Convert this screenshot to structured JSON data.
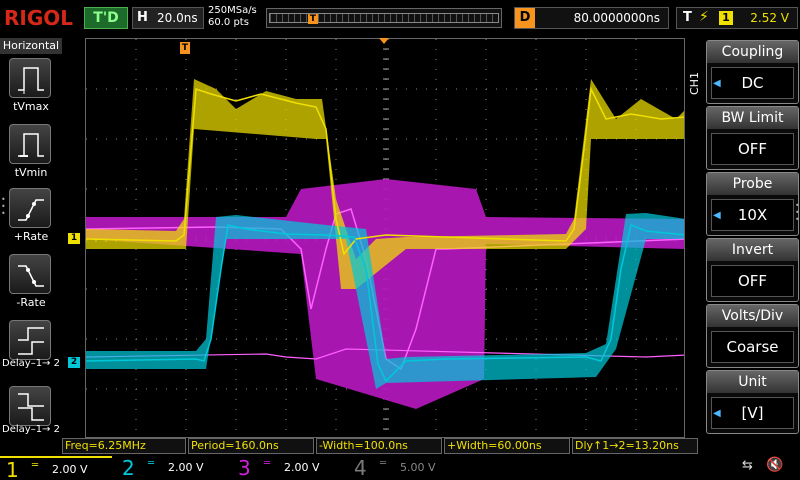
{
  "topbar": {
    "logo": "RIGOL",
    "trigger_status": "T'D",
    "timebase_label": "H",
    "timebase_value": "20.0ns",
    "sample_rate": "250MSa/s",
    "sample_points": "60.0 pts",
    "delay_label": "D",
    "delay_value": "80.0000000ns",
    "trigger_label": "T",
    "trigger_edge": "⚡",
    "trigger_source": "1",
    "trigger_level": "2.52 V"
  },
  "left": {
    "title": "Horizontal",
    "buttons": [
      {
        "label": "tVmax"
      },
      {
        "label": "tVmin"
      },
      {
        "label": "+Rate"
      },
      {
        "label": "-Rate"
      },
      {
        "label": "Delay–1→ 2"
      },
      {
        "label": "Delay–1→ 2"
      }
    ]
  },
  "right": {
    "channel_tag": "CH1",
    "settings": [
      {
        "title": "Coupling",
        "value": "DC"
      },
      {
        "title": "BW Limit",
        "value": "OFF"
      },
      {
        "title": "Probe",
        "value": "10X"
      },
      {
        "title": "Invert",
        "value": "OFF"
      },
      {
        "title": "Volts/Div",
        "value": "Coarse"
      },
      {
        "title": "Unit",
        "value": "[V]"
      }
    ]
  },
  "measurements": [
    {
      "text": "Freq=6.25MHz"
    },
    {
      "text": "Period=160.0ns"
    },
    {
      "text": "-Width=100.0ns"
    },
    {
      "text": "+Width=60.00ns"
    },
    {
      "text": "Dly↑1→2=13.20ns"
    }
  ],
  "channels": [
    {
      "number": "1",
      "coupling": "═",
      "scale": "2.00 V",
      "color": "#f0e000"
    },
    {
      "number": "2",
      "coupling": "═",
      "scale": "2.00 V",
      "color": "#00c8d8"
    },
    {
      "number": "3",
      "coupling": "═",
      "scale": "2.00 V",
      "color": "#d020d8"
    },
    {
      "number": "4",
      "coupling": "═",
      "scale": "5.00 V",
      "color": "#7a7a7a"
    }
  ],
  "markers": {
    "ch1_marker": "1",
    "ch2_marker": "2",
    "trigger_marker": "T"
  },
  "colors": {
    "ch1": "#f0e000",
    "ch2": "#00c8d8",
    "ch3": "#b018b8",
    "ch3_trace": "#ff60ff",
    "trigger": "#f7941d"
  }
}
